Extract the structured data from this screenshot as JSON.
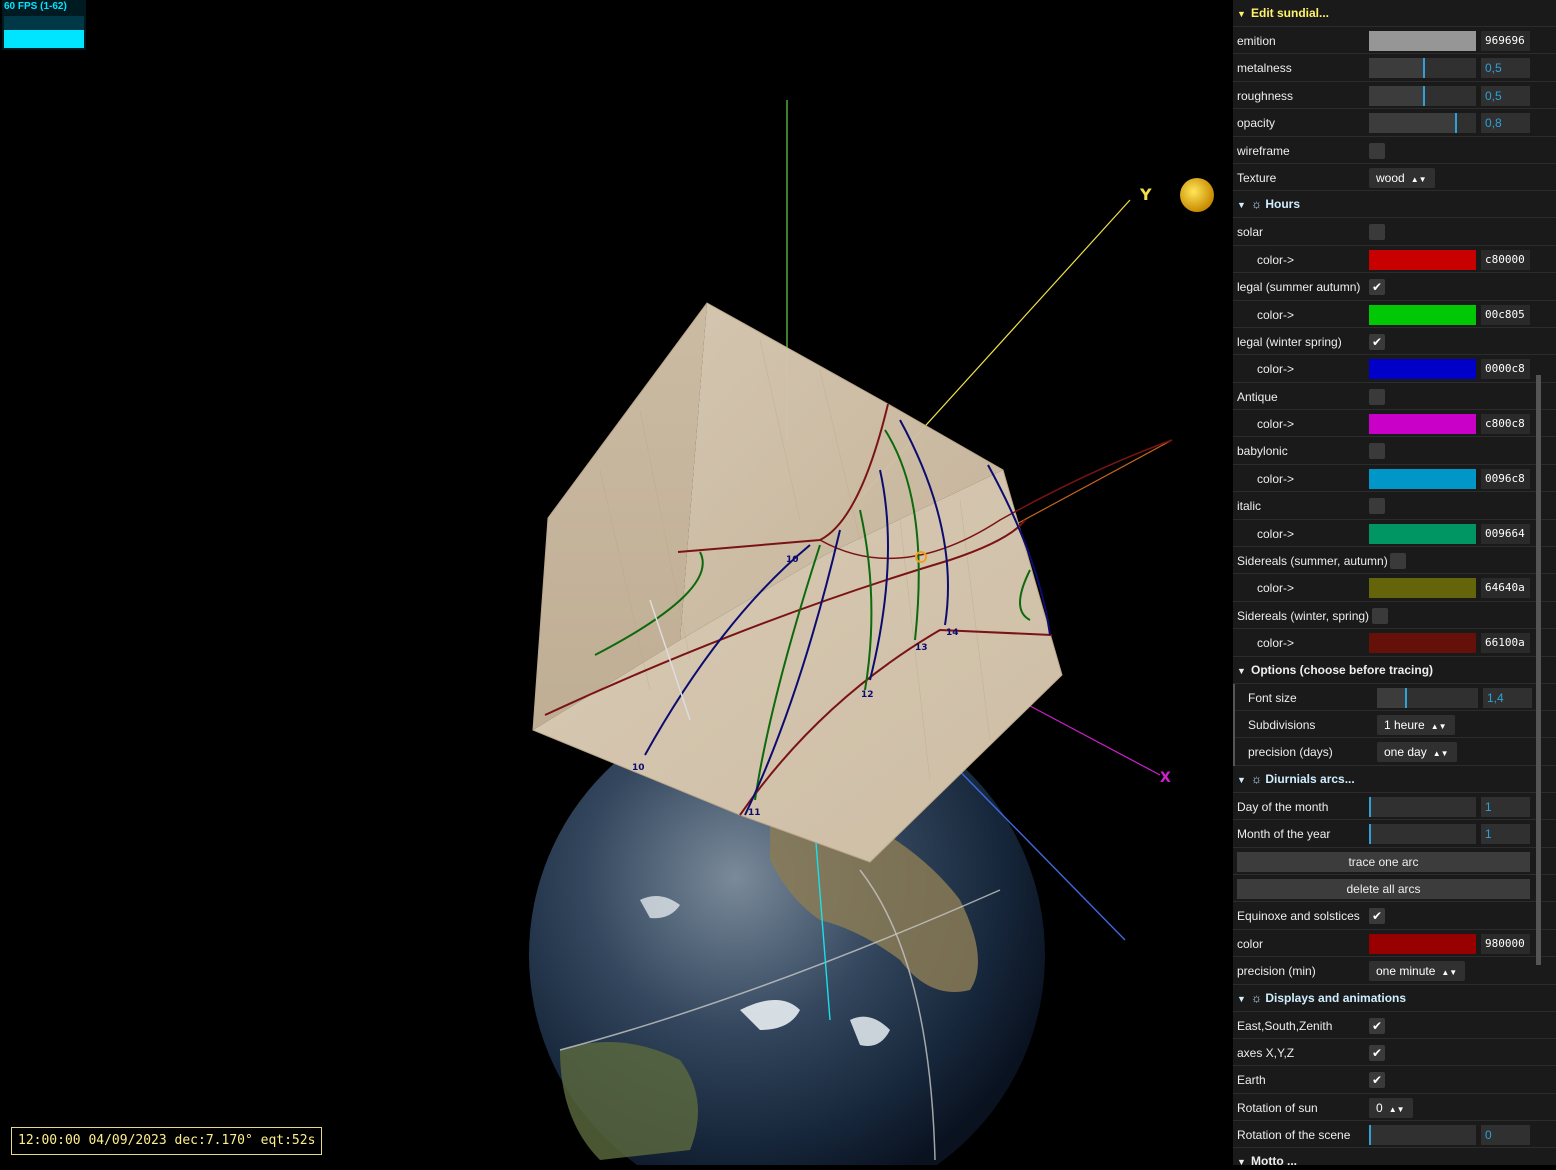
{
  "fps": {
    "label": "60 FPS (1-62)"
  },
  "status": {
    "text": "12:00:00 04/09/2023 dec:7.170° eqt:52s"
  },
  "scene": {
    "axis_labels": {
      "y": "Y",
      "x": "X"
    },
    "hour_labels": [
      "10",
      "11",
      "12",
      "13",
      "14",
      "10"
    ]
  },
  "gui": {
    "edit": {
      "title": "Edit sundial...",
      "emition_label": "emition",
      "emition_color": "#969696",
      "emition_hex": "969696",
      "metalness_label": "metalness",
      "metalness_value": "0,5",
      "metalness_fraction": 0.5,
      "roughness_label": "roughness",
      "roughness_value": "0,5",
      "roughness_fraction": 0.5,
      "opacity_label": "opacity",
      "opacity_value": "0,8",
      "opacity_fraction": 0.8,
      "wireframe_label": "wireframe",
      "texture_label": "Texture",
      "texture_value": "wood"
    },
    "hours": {
      "title": "Hours",
      "items": [
        {
          "label": "solar",
          "checked": "",
          "color_label": "color->",
          "color": "#c80000",
          "hex": "c80000"
        },
        {
          "label": "legal (summer autumn)",
          "checked": "✔",
          "color_label": "color->",
          "color": "#00c805",
          "hex": "00c805"
        },
        {
          "label": "legal (winter spring)",
          "checked": "✔",
          "color_label": "color->",
          "color": "#0000c8",
          "hex": "0000c8"
        },
        {
          "label": "Antique",
          "checked": "",
          "color_label": "color->",
          "color": "#c800c8",
          "hex": "c800c8"
        },
        {
          "label": "babylonic",
          "checked": "",
          "color_label": "color->",
          "color": "#0096c8",
          "hex": "0096c8"
        },
        {
          "label": "italic",
          "checked": "",
          "color_label": "color->",
          "color": "#009664",
          "hex": "009664"
        },
        {
          "label": "Sidereals (summer, autumn)",
          "checked": "",
          "color_label": "color->",
          "color": "#64640a",
          "hex": "64640a"
        },
        {
          "label": "Sidereals (winter, spring)",
          "checked": "",
          "color_label": "color->",
          "color": "#66100a",
          "hex": "66100a"
        }
      ]
    },
    "options": {
      "title": "Options (choose before tracing)",
      "font_size_label": "Font size",
      "font_size_value": "1,4",
      "font_size_fraction": 0.28,
      "subdivisions_label": "Subdivisions",
      "subdivisions_value": "1 heure",
      "precision_label": "precision (days)",
      "precision_value": "one day"
    },
    "arcs": {
      "title": "Diurnials arcs...",
      "day_label": "Day of the month",
      "day_value": "1",
      "month_label": "Month of the year",
      "month_value": "1",
      "trace_button": "trace one arc",
      "delete_button": "delete all arcs",
      "equinox_label": "Equinoxe and solstices",
      "equinox_checked": "✔",
      "color_label": "color",
      "color": "#980000",
      "hex": "980000",
      "precision_label": "precision (min)",
      "precision_value": "one minute"
    },
    "displays": {
      "title": "Displays and animations",
      "esz_label": "East,South,Zenith",
      "esz_checked": "✔",
      "axes_label": "axes X,Y,Z",
      "axes_checked": "✔",
      "earth_label": "Earth",
      "earth_checked": "✔",
      "sun_rotation_label": "Rotation of sun",
      "sun_rotation_value": "0",
      "scene_rotation_label": "Rotation of the scene",
      "scene_rotation_value": "0"
    },
    "motto": {
      "title": "Motto ..."
    }
  }
}
